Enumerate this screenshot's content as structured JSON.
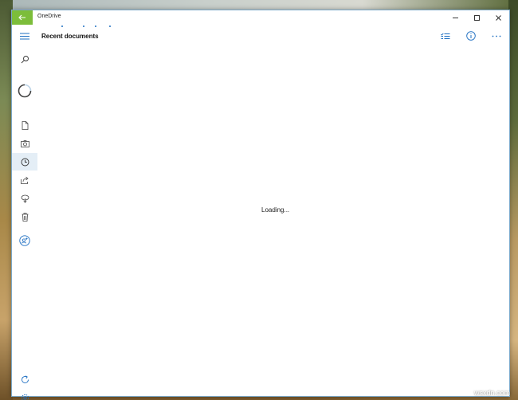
{
  "window": {
    "title": "OneDrive"
  },
  "header": {
    "title": "Recent documents"
  },
  "main": {
    "status_text": "Loading..."
  },
  "nav": {
    "items": [
      {
        "icon": "hamburger-menu-icon"
      },
      {
        "icon": "search-icon"
      },
      {
        "icon": "loading-spinner-icon"
      },
      {
        "icon": "files-icon"
      },
      {
        "icon": "photos-icon"
      },
      {
        "icon": "recent-icon",
        "active": true
      },
      {
        "icon": "shared-icon"
      },
      {
        "icon": "offline-icon"
      },
      {
        "icon": "recycle-bin-icon"
      },
      {
        "icon": "add-account-icon"
      },
      {
        "icon": "refresh-icon"
      },
      {
        "icon": "settings-icon"
      }
    ]
  },
  "header_actions": [
    {
      "icon": "select-icon"
    },
    {
      "icon": "info-icon"
    },
    {
      "icon": "more-icon"
    }
  ],
  "colors": {
    "accent": "#7cbd3a",
    "icon_blue": "#1e6fc2",
    "active_nav_bg": "#e4eef6"
  },
  "watermark": "wsxdn.com"
}
